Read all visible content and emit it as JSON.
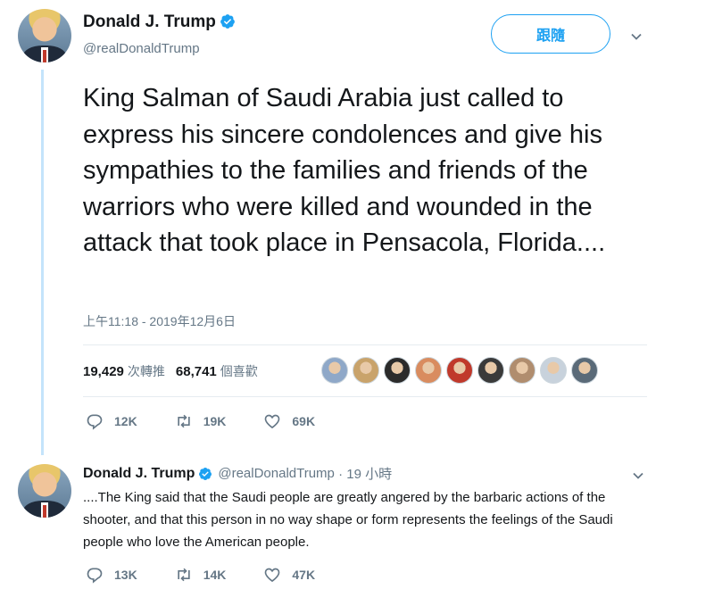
{
  "main_tweet": {
    "display_name": "Donald J. Trump",
    "handle": "@realDonaldTrump",
    "follow_label": "跟隨",
    "text": "King Salman of Saudi Arabia just called to express his sincere condolences and give his sympathies to the families and friends of the warriors who were killed and wounded in the attack that took place in Pensacola, Florida....",
    "timestamp": "上午11:18 - 2019年12月6日",
    "retweet_count": "19,429",
    "retweet_label": "次轉推",
    "like_count": "68,741",
    "like_label": "個喜歡",
    "liker_colors": [
      "#8fa8c8",
      "#c9a36b",
      "#2b2b2b",
      "#d98c5f",
      "#c0392b",
      "#3a3a3a",
      "#b08d6e",
      "#c8d2dc",
      "#5a6a78"
    ],
    "actions": {
      "reply": "12K",
      "retweet": "19K",
      "like": "69K"
    }
  },
  "reply_tweet": {
    "display_name": "Donald J. Trump",
    "handle": "@realDonaldTrump",
    "time_ago": "· 19 小時",
    "text": "....The King said that the Saudi people are greatly angered by the barbaric actions of the shooter, and that this person in no way shape or form represents the feelings of the Saudi people who love the American people.",
    "actions": {
      "reply": "13K",
      "retweet": "14K",
      "like": "47K"
    }
  },
  "colors": {
    "accent": "#1da1f2",
    "secondary_text": "#657786",
    "thread_line": "#c4e4fb"
  }
}
